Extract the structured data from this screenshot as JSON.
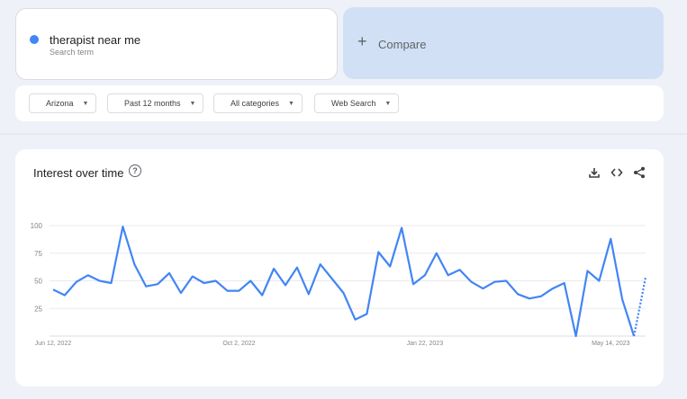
{
  "search_term": {
    "name": "therapist near me",
    "subtitle": "Search term",
    "color": "#4285f4"
  },
  "compare": {
    "label": "Compare"
  },
  "filters": {
    "region": "Arizona",
    "time_range": "Past 12 months",
    "category": "All categories",
    "search_type": "Web Search"
  },
  "chart_panel": {
    "title": "Interest over time",
    "icons": [
      "help-icon",
      "download-icon",
      "embed-icon",
      "share-icon"
    ]
  },
  "chart_data": {
    "type": "line",
    "title": "Interest over time",
    "xlabel": "",
    "ylabel": "",
    "ylim": [
      0,
      100
    ],
    "yticks": [
      25,
      50,
      75,
      100
    ],
    "x_tick_labels": [
      "Jun 12, 2022",
      "Oct 2, 2022",
      "Jan 22, 2023",
      "May 14, 2023"
    ],
    "x_tick_week_index": [
      0,
      16,
      32,
      48
    ],
    "grid": true,
    "series": [
      {
        "color": "#4285f4",
        "values": [
          42,
          37,
          49,
          55,
          50,
          48,
          99,
          65,
          45,
          47,
          57,
          39,
          54,
          48,
          50,
          41,
          41,
          50,
          37,
          61,
          46,
          62,
          38,
          65,
          52,
          39,
          15,
          20,
          76,
          63,
          98,
          47,
          55,
          75,
          55,
          60,
          49,
          43,
          49,
          50,
          38,
          34,
          36,
          43,
          48,
          0,
          59,
          50,
          88,
          33,
          0
        ],
        "partial_last_value": 53
      }
    ]
  }
}
